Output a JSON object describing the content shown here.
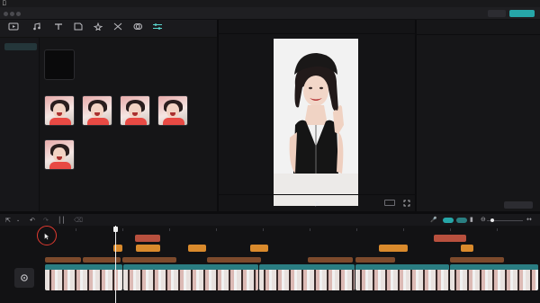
{
  "menubar": {
    "items": [
      "",
      "",
      "",
      ""
    ]
  },
  "titlebar": {
    "center_title": "",
    "left_info": "",
    "action_btn_1": "",
    "action_btn_2": "",
    "right_watermark": ""
  },
  "toolbar": {
    "tools": [
      {
        "label": "",
        "icon": "media-icon"
      },
      {
        "label": "",
        "icon": "audio-icon"
      },
      {
        "label": "",
        "icon": "text-icon"
      },
      {
        "label": "",
        "icon": "sticker-icon"
      },
      {
        "label": "",
        "icon": "effects-icon"
      },
      {
        "label": "",
        "icon": "transition-icon"
      },
      {
        "label": "",
        "icon": "filter-icon"
      },
      {
        "label": "",
        "icon": "adjust-icon"
      }
    ]
  },
  "sidenav": {
    "items": [
      {
        "label": ""
      },
      {
        "label": ""
      },
      {
        "label": ""
      },
      {
        "label": ""
      }
    ]
  },
  "media": {
    "section1_title": "",
    "create_adjust_card": "",
    "section2_title": "",
    "thumbs": [
      {
        "caption": ""
      },
      {
        "caption": ""
      },
      {
        "caption": ""
      },
      {
        "caption": ""
      },
      {
        "caption": ""
      }
    ]
  },
  "player": {
    "title": "",
    "time_current": "",
    "time_total": "",
    "ratio_btn": ""
  },
  "props": {
    "title": "",
    "rows": [
      {
        "key": "",
        "value": ""
      },
      {
        "key": "",
        "value": ""
      },
      {
        "key": "",
        "value": ""
      },
      {
        "key": "",
        "value": ""
      },
      {
        "key": "",
        "value": ""
      }
    ],
    "edit_btn": ""
  },
  "timeline": {
    "clips_row1": [
      {
        "label": ""
      },
      {
        "label": ""
      }
    ],
    "clips_row2": [
      {
        "label": ""
      },
      {
        "label": ""
      },
      {
        "label": ""
      },
      {
        "label": ""
      }
    ],
    "clips_row3": [
      {
        "label": ""
      },
      {
        "label": ""
      },
      {
        "label": ""
      },
      {
        "label": ""
      },
      {
        "label": ""
      },
      {
        "label": ""
      },
      {
        "label": ""
      }
    ],
    "video_tracks": [
      {
        "label": ""
      },
      {
        "label": ""
      },
      {
        "label": ""
      },
      {
        "label": ""
      },
      {
        "label": ""
      }
    ]
  },
  "colors": {
    "accent_teal": "#5ad7d0",
    "btn_teal": "#26a6a8",
    "clip_orange": "#d98a2c",
    "clip_red": "#b8503e",
    "highlight_red": "#e03a30"
  }
}
